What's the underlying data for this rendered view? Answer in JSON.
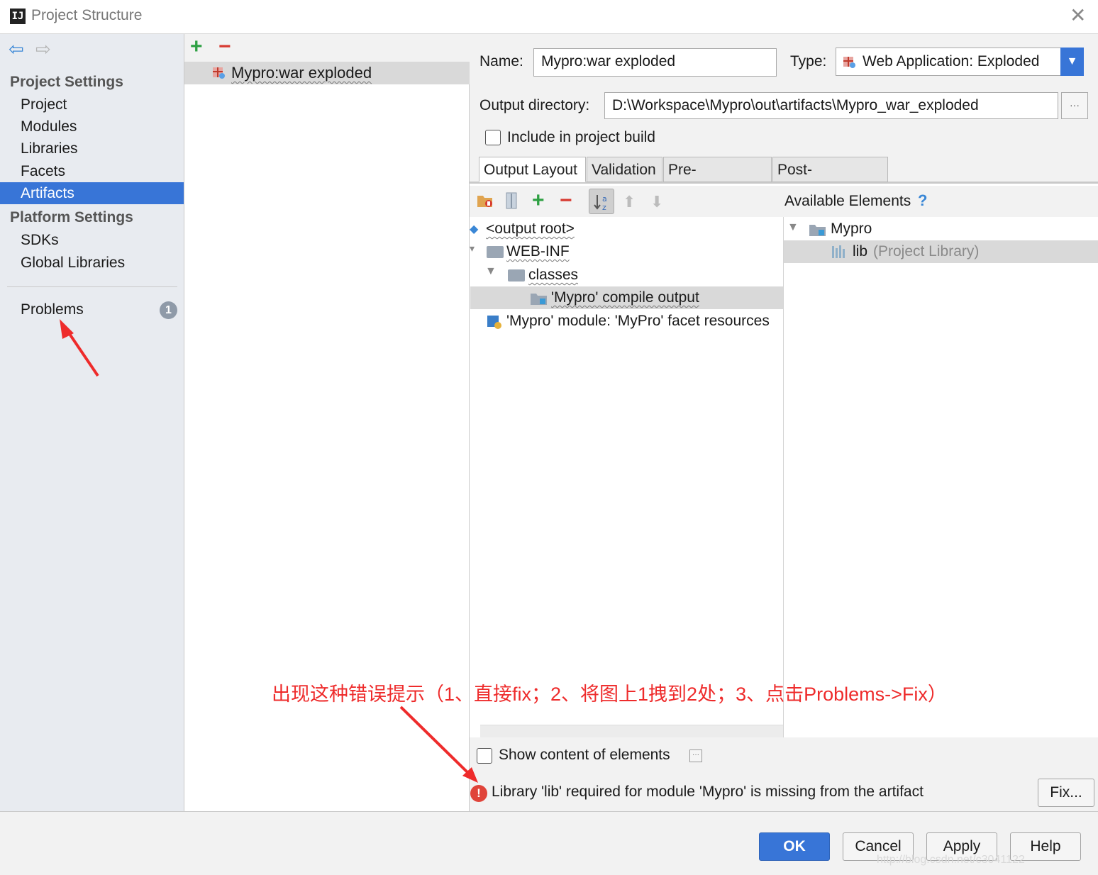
{
  "window": {
    "title": "Project Structure"
  },
  "sidebar": {
    "project_settings_header": "Project Settings",
    "project_items": [
      "Project",
      "Modules",
      "Libraries",
      "Facets",
      "Artifacts"
    ],
    "selected": "Artifacts",
    "platform_settings_header": "Platform Settings",
    "platform_items": [
      "SDKs",
      "Global Libraries"
    ],
    "problems_label": "Problems",
    "problems_count": "1"
  },
  "artifacts_list": {
    "items": [
      "Mypro:war exploded"
    ]
  },
  "form": {
    "name_label": "Name:",
    "name_value": "Mypro:war exploded",
    "type_label": "Type:",
    "type_value": "Web Application: Exploded",
    "output_label": "Output directory:",
    "output_value": "D:\\Workspace\\Mypro\\out\\artifacts\\Mypro_war_exploded",
    "include_label": "Include in project build",
    "include_checked": false
  },
  "tabs": [
    "Output Layout",
    "Validation",
    "Pre-processing",
    "Post-processing"
  ],
  "active_tab": "Output Layout",
  "layout_tree": {
    "root": "<output root>",
    "web_inf": "WEB-INF",
    "classes": "classes",
    "compile_output": "'Mypro' compile output",
    "facet_resources": "'Mypro' module: 'MyPro' facet resources"
  },
  "available": {
    "header": "Available Elements",
    "help": "?",
    "module": "Mypro",
    "lib_name": "lib",
    "lib_suffix": "(Project Library)"
  },
  "show_content_label": "Show content of elements",
  "error": {
    "message": "Library 'lib' required for module 'Mypro' is missing from the artifact",
    "fix_button": "Fix..."
  },
  "buttons": {
    "ok": "OK",
    "cancel": "Cancel",
    "apply": "Apply",
    "help": "Help"
  },
  "annotation": "出现这种错误提示（1、直接fix；2、将图上1拽到2处；3、点击Problems->Fix）",
  "watermark": "http://blog.csdn.net/c3041122",
  "colors": {
    "selection": "#3875d7",
    "annotation": "#ee2b2b",
    "add": "#2ea043",
    "remove": "#d73a31"
  }
}
